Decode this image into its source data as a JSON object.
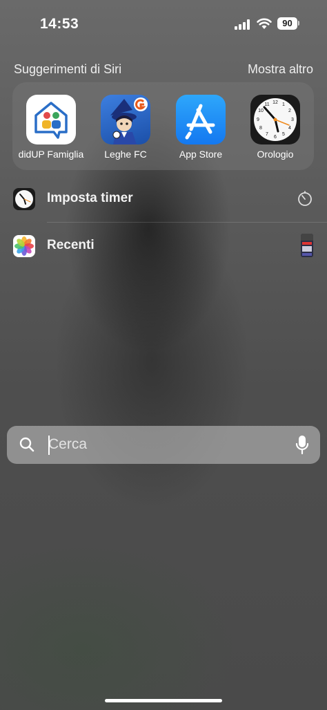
{
  "status_bar": {
    "time": "14:53",
    "battery_level": "90",
    "signal_icon": "cellular-signal-icon",
    "wifi_icon": "wifi-icon"
  },
  "siri_suggestions": {
    "title": "Suggerimenti di Siri",
    "more_label": "Mostra altro",
    "apps": [
      {
        "label": "didUP Famiglia",
        "icon": "didup-famiglia-app-icon"
      },
      {
        "label": "Leghe FC",
        "icon": "leghe-fc-app-icon"
      },
      {
        "label": "App Store",
        "icon": "app-store-app-icon"
      },
      {
        "label": "Orologio",
        "icon": "clock-app-icon"
      }
    ]
  },
  "shortcuts": [
    {
      "label": "Imposta timer",
      "icon": "clock-app-icon",
      "trailing_icon": "timer-icon"
    },
    {
      "label": "Recenti",
      "icon": "photos-app-icon",
      "trailing_icon": "photo-thumbnail"
    }
  ],
  "search": {
    "placeholder": "Cerca",
    "value": ""
  },
  "colors": {
    "app_store_blue": "#1a8cf7",
    "leghe_blue": "#2b6fd6",
    "clock_orange": "#f08a1c"
  }
}
